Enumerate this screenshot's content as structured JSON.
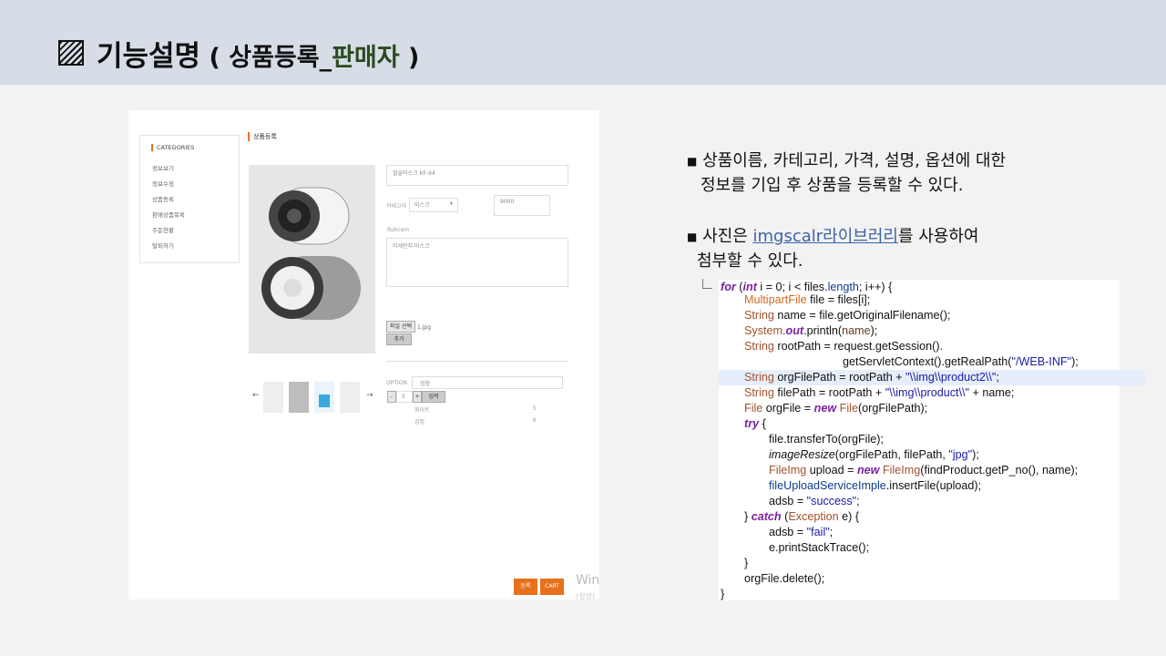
{
  "slide": {
    "title_main": "기능설명",
    "title_open": " ( 상품등록_",
    "title_seller": "판매자",
    "title_close": " )"
  },
  "screenshot": {
    "categories_heading": "CATEGORIES",
    "categories": [
      "정보보기",
      "정보수정",
      "상품등록",
      "판매상품목록",
      "주문현황",
      "탈퇴하기"
    ],
    "page_heading": "상품등록",
    "product_name_value": "잘술마스크 KF-94",
    "category_label": "카테고리",
    "category_value": "마스크",
    "price_value": "9000",
    "brand_value": "Rokcom",
    "desc_value": "미세먼지 마스크",
    "file_button": "파일 선택",
    "file_name": "1.jpg",
    "add_button": "추가",
    "option_label": "OPTION",
    "option_value": "검정",
    "qty_minus": "-",
    "qty_value": "5",
    "qty_plus": "+",
    "enter_button": "입력",
    "option_rows": [
      {
        "name": "화이트",
        "qty": "5"
      },
      {
        "name": "검정",
        "qty": "6"
      }
    ],
    "register_button": "등록",
    "cart_button": "CART",
    "watermark_1": "Winc",
    "watermark_2": "(설정)"
  },
  "bullets": {
    "b1_line1": "상품이름, 카테고리, 가격, 설명, 옵션에 대한",
    "b1_line2": "정보를 기입 후 상품을 등록할 수 있다.",
    "b2_pre": "사진은 ",
    "b2_link": "imgscalr라이브러리",
    "b2_post": "를 사용하여",
    "b2_line2": "첨부할 수 있다."
  },
  "code_lines": [
    "for (int i = 0; i < files.length; i++) {",
    "MultipartFile file = files[i];",
    "String name = file.getOriginalFilename();",
    "System.out.println(name);",
    "String rootPath = request.getSession().",
    "getServletContext().getRealPath(\"/WEB-INF\");",
    "String orgFilePath = rootPath + \"\\\\img\\\\product2\\\\\";",
    "String filePath = rootPath + \"\\\\img\\\\product\\\\\" + name;",
    "File orgFile = new File(orgFilePath);",
    "try {",
    "file.transferTo(orgFile);",
    "imageResize(orgFilePath, filePath, \"jpg\");",
    "FileImg upload = new FileImg(findProduct.getP_no(), name);",
    "fileUploadServiceImple.insertFile(upload);",
    "adsb = \"success\";",
    "} catch (Exception e) {",
    "adsb = \"fail\";",
    "e.printStackTrace();",
    "}",
    "orgFile.delete();",
    "}"
  ],
  "colors": {
    "header_bg": "#d6dde6",
    "accent_orange": "#e8711c",
    "seller_green": "#2b4a1e",
    "keyword_purple": "#7a1fa2",
    "link_blue": "#3a63a8"
  }
}
